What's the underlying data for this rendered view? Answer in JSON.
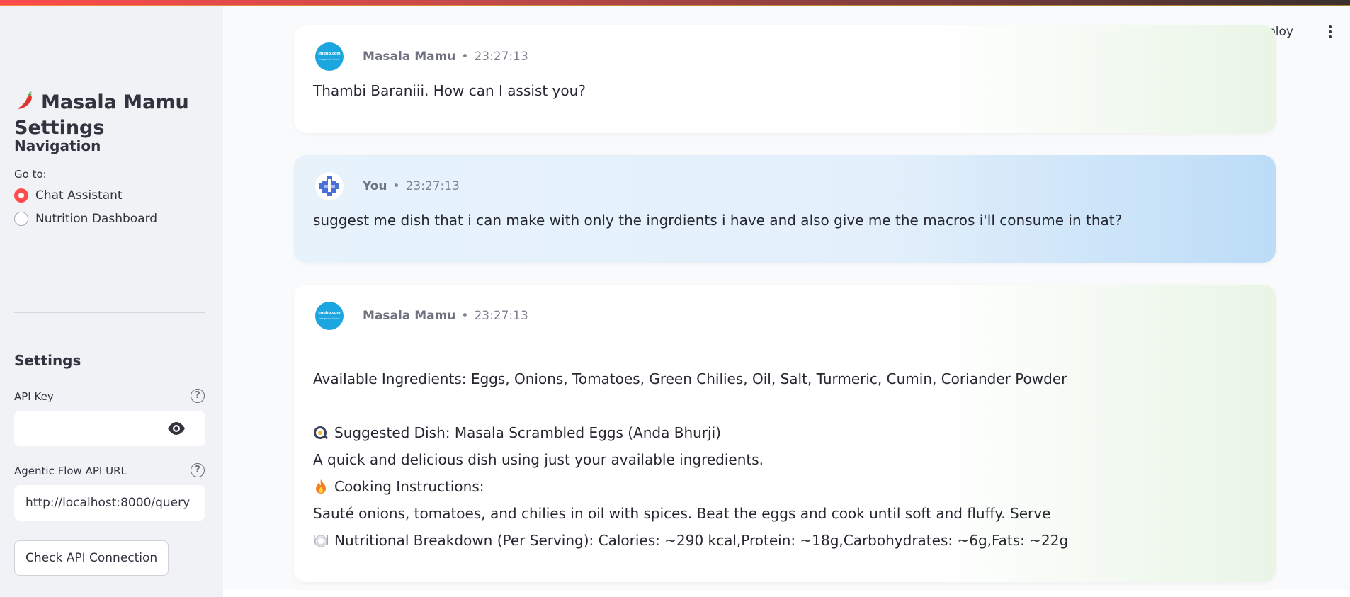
{
  "sidebar": {
    "title": "Masala Mamu Settings",
    "navigation_heading": "Navigation",
    "goto_label": "Go to:",
    "nav_options": [
      {
        "label": "Chat Assistant",
        "selected": true
      },
      {
        "label": "Nutrition Dashboard",
        "selected": false
      }
    ],
    "settings_heading": "Settings",
    "api_key_label": "API Key",
    "api_key_value": "",
    "api_url_label": "Agentic Flow API URL",
    "api_url_value": "http://localhost:8000/query",
    "check_button": "Check API Connection",
    "help_glyph": "?"
  },
  "header": {
    "deploy_label": "Deploy"
  },
  "chat": {
    "messages": [
      {
        "role": "assistant",
        "name": "Masala Mamu",
        "time": "23:27:13",
        "avatar_text": "imgbb.com",
        "avatar_subtext": "image not found",
        "lines": [
          "Thambi Baraniii. How can I assist you?"
        ]
      },
      {
        "role": "user",
        "name": "You",
        "time": "23:27:13",
        "lines": [
          "suggest me dish that i can make with only the ingrdients i have and also give me the macros i'll consume in that?"
        ]
      },
      {
        "role": "assistant",
        "name": "Masala Mamu",
        "time": "23:27:13",
        "avatar_text": "imgbb.com",
        "avatar_subtext": "image not found",
        "lines": [
          "Available Ingredients: Eggs, Onions, Tomatoes, Green Chilies, Oil, Salt, Turmeric, Cumin, Coriander Powder",
          "Suggested Dish: Masala Scrambled Eggs (Anda Bhurji)",
          "A quick and delicious dish using just your available ingredients.",
          "Cooking Instructions:",
          "Sauté onions, tomatoes, and chilies in oil with spices. Beat the eggs and cook until soft and fluffy. Serve",
          "Nutritional Breakdown (Per Serving): Calories: ~290 kcal,Protein: ~18g,Carbohydrates: ~6g,Fats: ~22g"
        ]
      }
    ]
  },
  "icons": {
    "title": "chili-pepper-icon",
    "dish": "frying-pan-icon",
    "cooking": "fire-icon",
    "nutrition": "plate-icon",
    "password_toggle": "eye-icon",
    "menu": "kebab-menu-icon"
  },
  "colors": {
    "accent": "#ff4b4b",
    "sidebar_bg": "#f0f2f6",
    "user_bubble": "#e3f0fb",
    "assistant_tint": "#e9f5e6"
  }
}
